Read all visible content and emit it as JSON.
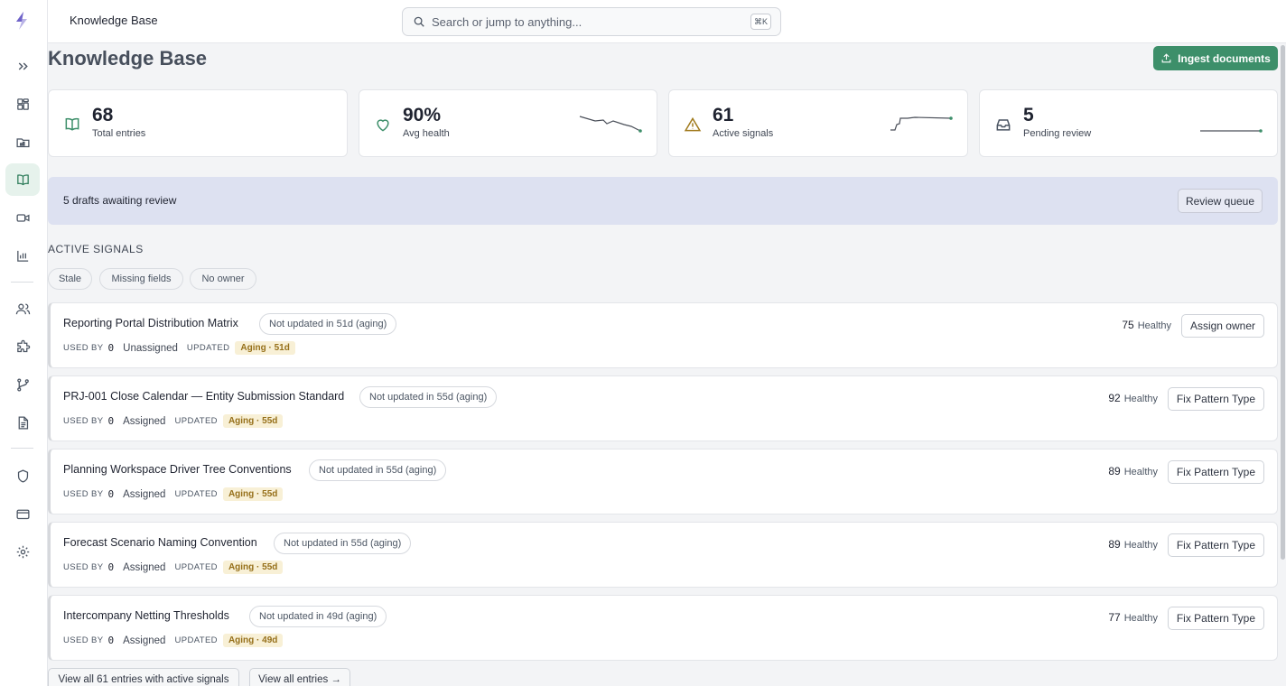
{
  "sidebar": {
    "items": [
      {
        "icon": "expand-icon"
      },
      {
        "icon": "dashboard-icon"
      },
      {
        "icon": "folder-icon"
      },
      {
        "icon": "book-icon",
        "active": true
      },
      {
        "icon": "video-icon"
      },
      {
        "icon": "chart-icon"
      },
      {
        "icon": "users-icon"
      },
      {
        "icon": "puzzle-icon"
      },
      {
        "icon": "branch-icon"
      },
      {
        "icon": "document-icon"
      },
      {
        "icon": "shield-icon"
      },
      {
        "icon": "card-icon"
      },
      {
        "icon": "gear-icon"
      }
    ]
  },
  "header": {
    "title": "Knowledge Base",
    "search_placeholder": "Search or jump to anything...",
    "shortcut": "⌘K"
  },
  "page": {
    "title": "Knowledge Base",
    "ingest_label": "Ingest documents"
  },
  "stats": [
    {
      "value": "68",
      "label": "Total entries",
      "icon": "book-open-icon"
    },
    {
      "value": "90%",
      "label": "Avg health",
      "icon": "heart-icon"
    },
    {
      "value": "61",
      "label": "Active signals",
      "icon": "warning-icon"
    },
    {
      "value": "5",
      "label": "Pending review",
      "icon": "inbox-icon"
    }
  ],
  "banner": {
    "text": "5 drafts awaiting review",
    "button": "Review queue"
  },
  "signals": {
    "title": "ACTIVE SIGNALS",
    "filters": [
      "Stale",
      "Missing fields",
      "No owner"
    ],
    "used_by_label": "USED BY",
    "updated_label": "UPDATED",
    "health_label": "Healthy",
    "rows": [
      {
        "title": "Reporting Portal Distribution Matrix",
        "chip": "Not updated in 51d (aging)",
        "used_by": "0",
        "owner": "Unassigned",
        "aging": "Aging · 51d",
        "score": "75",
        "action": "Assign owner"
      },
      {
        "title": "PRJ-001 Close Calendar — Entity Submission Standard",
        "chip": "Not updated in 55d (aging)",
        "used_by": "0",
        "owner": "Assigned",
        "aging": "Aging · 55d",
        "score": "92",
        "action": "Fix Pattern Type"
      },
      {
        "title": "Planning Workspace Driver Tree Conventions",
        "chip": "Not updated in 55d (aging)",
        "used_by": "0",
        "owner": "Assigned",
        "aging": "Aging · 55d",
        "score": "89",
        "action": "Fix Pattern Type"
      },
      {
        "title": "Forecast Scenario Naming Convention",
        "chip": "Not updated in 55d (aging)",
        "used_by": "0",
        "owner": "Assigned",
        "aging": "Aging · 55d",
        "score": "89",
        "action": "Fix Pattern Type"
      },
      {
        "title": "Intercompany Netting Thresholds",
        "chip": "Not updated in 49d (aging)",
        "used_by": "0",
        "owner": "Assigned",
        "aging": "Aging · 49d",
        "score": "77",
        "action": "Fix Pattern Type"
      }
    ]
  },
  "footer": {
    "view_signals": "View all 61 entries with active signals",
    "view_all": "View all entries →"
  },
  "colors": {
    "accent": "#3d8f6a",
    "banner": "#dde1f1",
    "aging_bg": "#f8f0d6",
    "aging_text": "#96701a"
  }
}
